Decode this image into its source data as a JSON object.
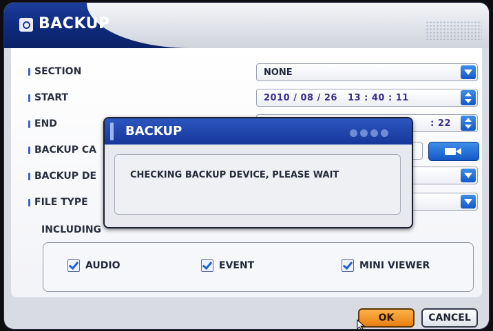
{
  "window": {
    "title": "BACKUP"
  },
  "rows": {
    "section": {
      "label": "SECTION",
      "value": "NONE"
    },
    "start": {
      "label": "START",
      "value": "2010 / 08 / 26   13 : 40 : 11"
    },
    "end": {
      "label": "END",
      "value": ": 22"
    },
    "backup_capacity": {
      "label": "BACKUP CA"
    },
    "backup_device": {
      "label": "BACKUP DE"
    },
    "file_type": {
      "label": "FILE TYPE"
    }
  },
  "including": {
    "label": "INCLUDING",
    "options": [
      {
        "label": "AUDIO",
        "checked": true
      },
      {
        "label": "EVENT",
        "checked": true
      },
      {
        "label": "MINI VIEWER",
        "checked": true
      }
    ]
  },
  "buttons": {
    "ok": "OK",
    "cancel": "CANCEL"
  },
  "popup": {
    "title": "BACKUP",
    "message": "CHECKING BACKUP DEVICE, PLEASE WAIT"
  },
  "icons": {
    "title": "backup-window-icon",
    "dropdown": "chevron-down-icon",
    "spinner": "spin-up-down-icon",
    "capacity": "camera-icon",
    "checkbox": "checkmark-icon",
    "cursor": "mouse-pointer-icon"
  },
  "colors": {
    "title_bar": "#0f2a7c",
    "accent_blue": "#1458c6",
    "ok_orange": "#e77e0f"
  }
}
